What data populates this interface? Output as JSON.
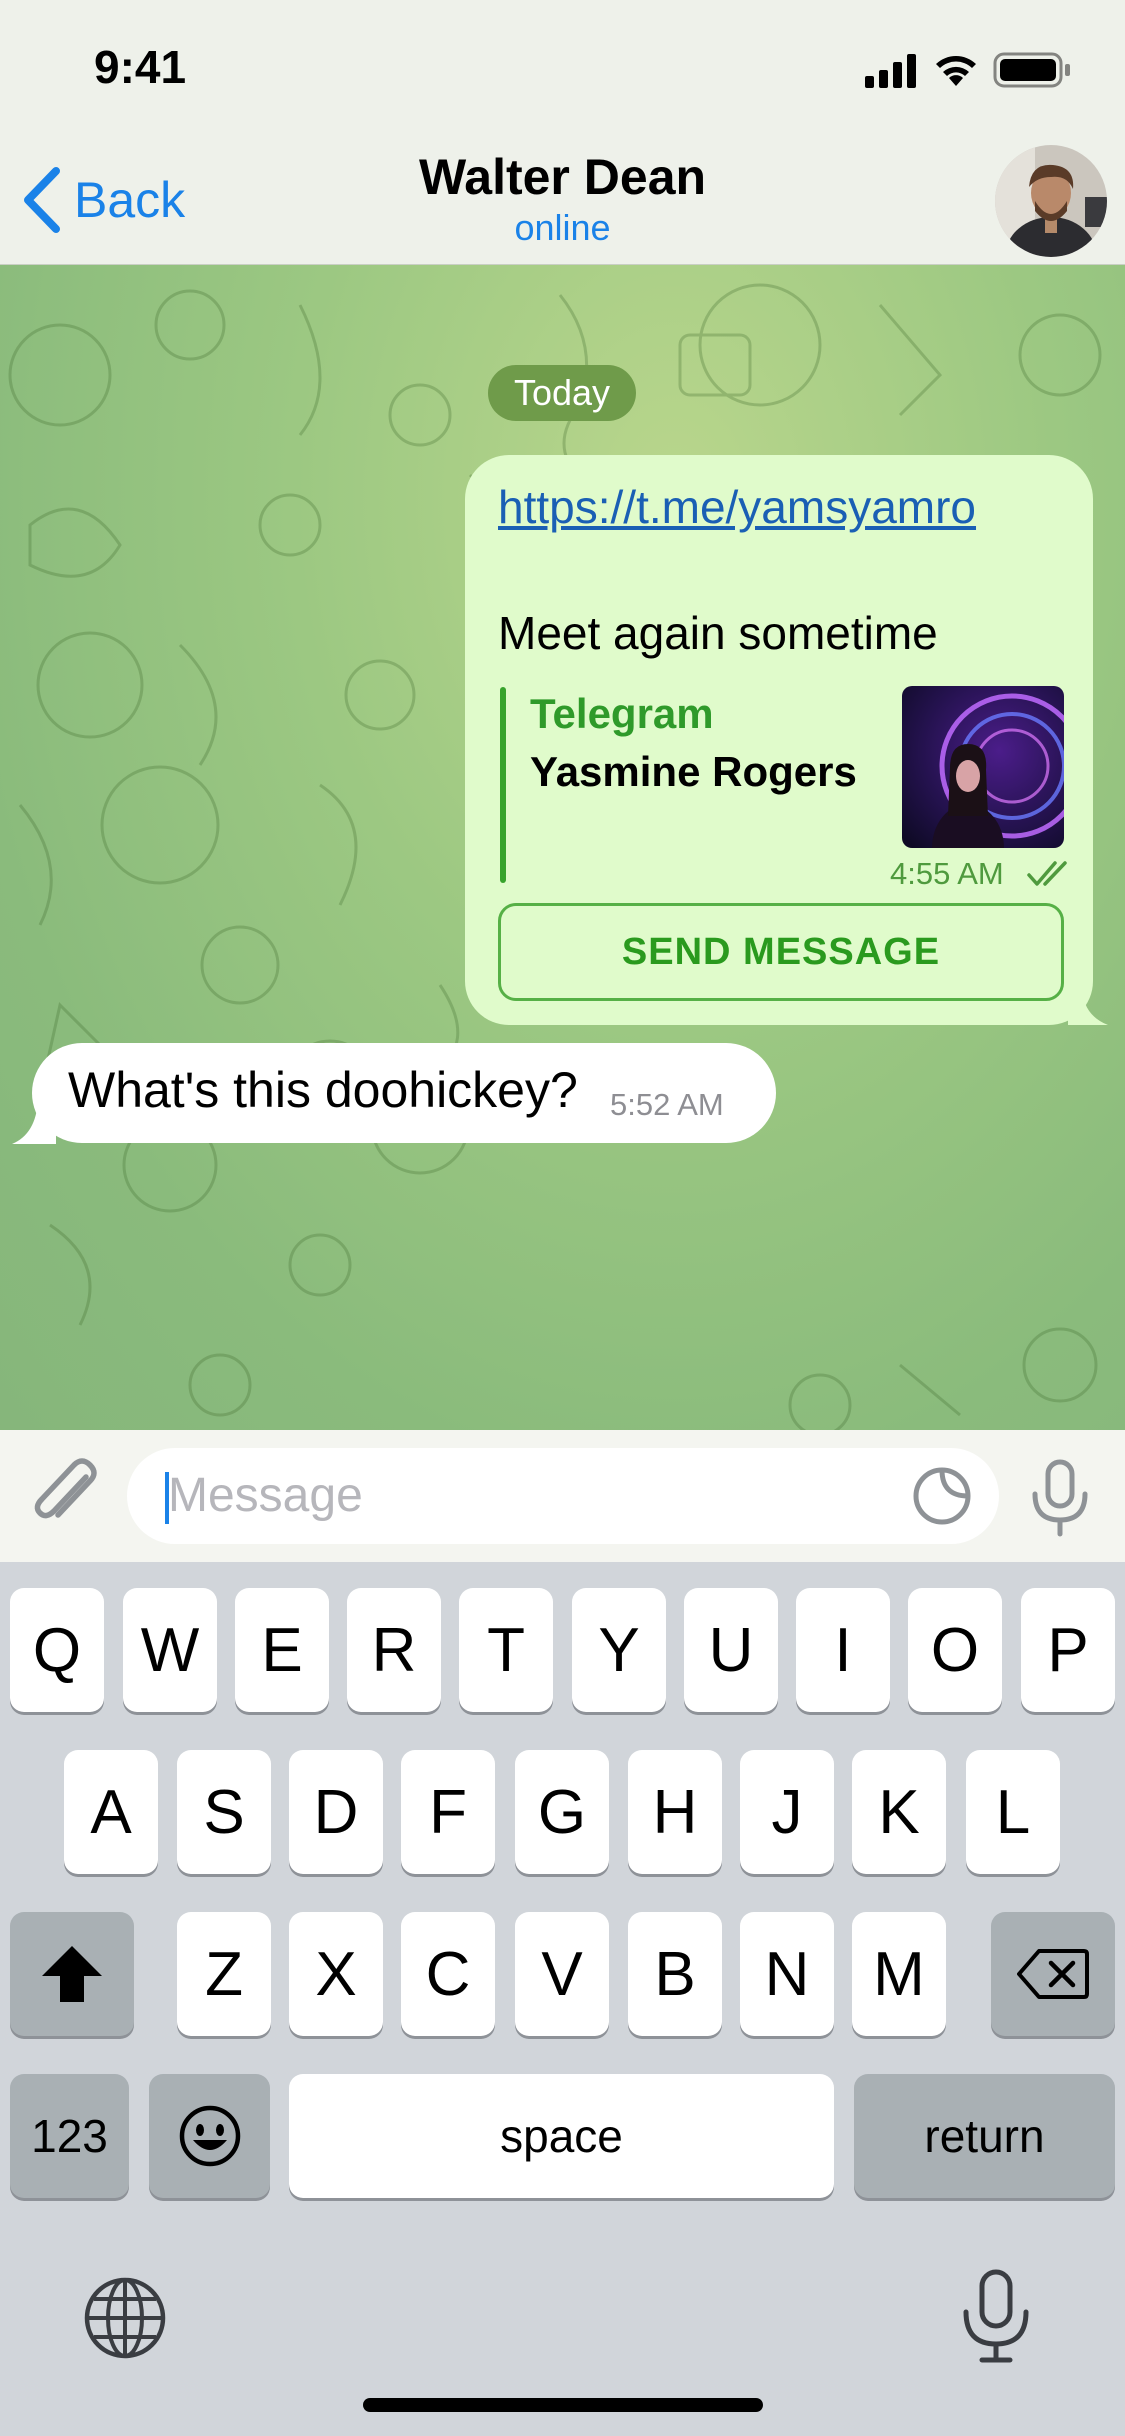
{
  "status_bar": {
    "time": "9:41"
  },
  "header": {
    "back_label": "Back",
    "contact_name": "Walter Dean",
    "contact_status": "online"
  },
  "chat": {
    "date_label": "Today",
    "outgoing": {
      "link": "https://t.me/yamsyamro",
      "text": "Meet again sometime",
      "preview_site": "Telegram",
      "preview_title": "Yasmine Rogers",
      "time": "4:55 AM",
      "button_label": "SEND MESSAGE"
    },
    "incoming": {
      "text": "What's this doohickey?",
      "time": "5:52 AM"
    }
  },
  "input": {
    "placeholder": "Message"
  },
  "keyboard": {
    "row1": [
      "Q",
      "W",
      "E",
      "R",
      "T",
      "Y",
      "U",
      "I",
      "O",
      "P"
    ],
    "row2": [
      "A",
      "S",
      "D",
      "F",
      "G",
      "H",
      "J",
      "K",
      "L"
    ],
    "row3": [
      "Z",
      "X",
      "C",
      "V",
      "B",
      "N",
      "M"
    ],
    "numbers_label": "123",
    "space_label": "space",
    "return_label": "return"
  },
  "colors": {
    "accent": "#1a82e8",
    "outgoing_bubble": "#e0fbcb",
    "telegram_green": "#2f9a2a"
  }
}
